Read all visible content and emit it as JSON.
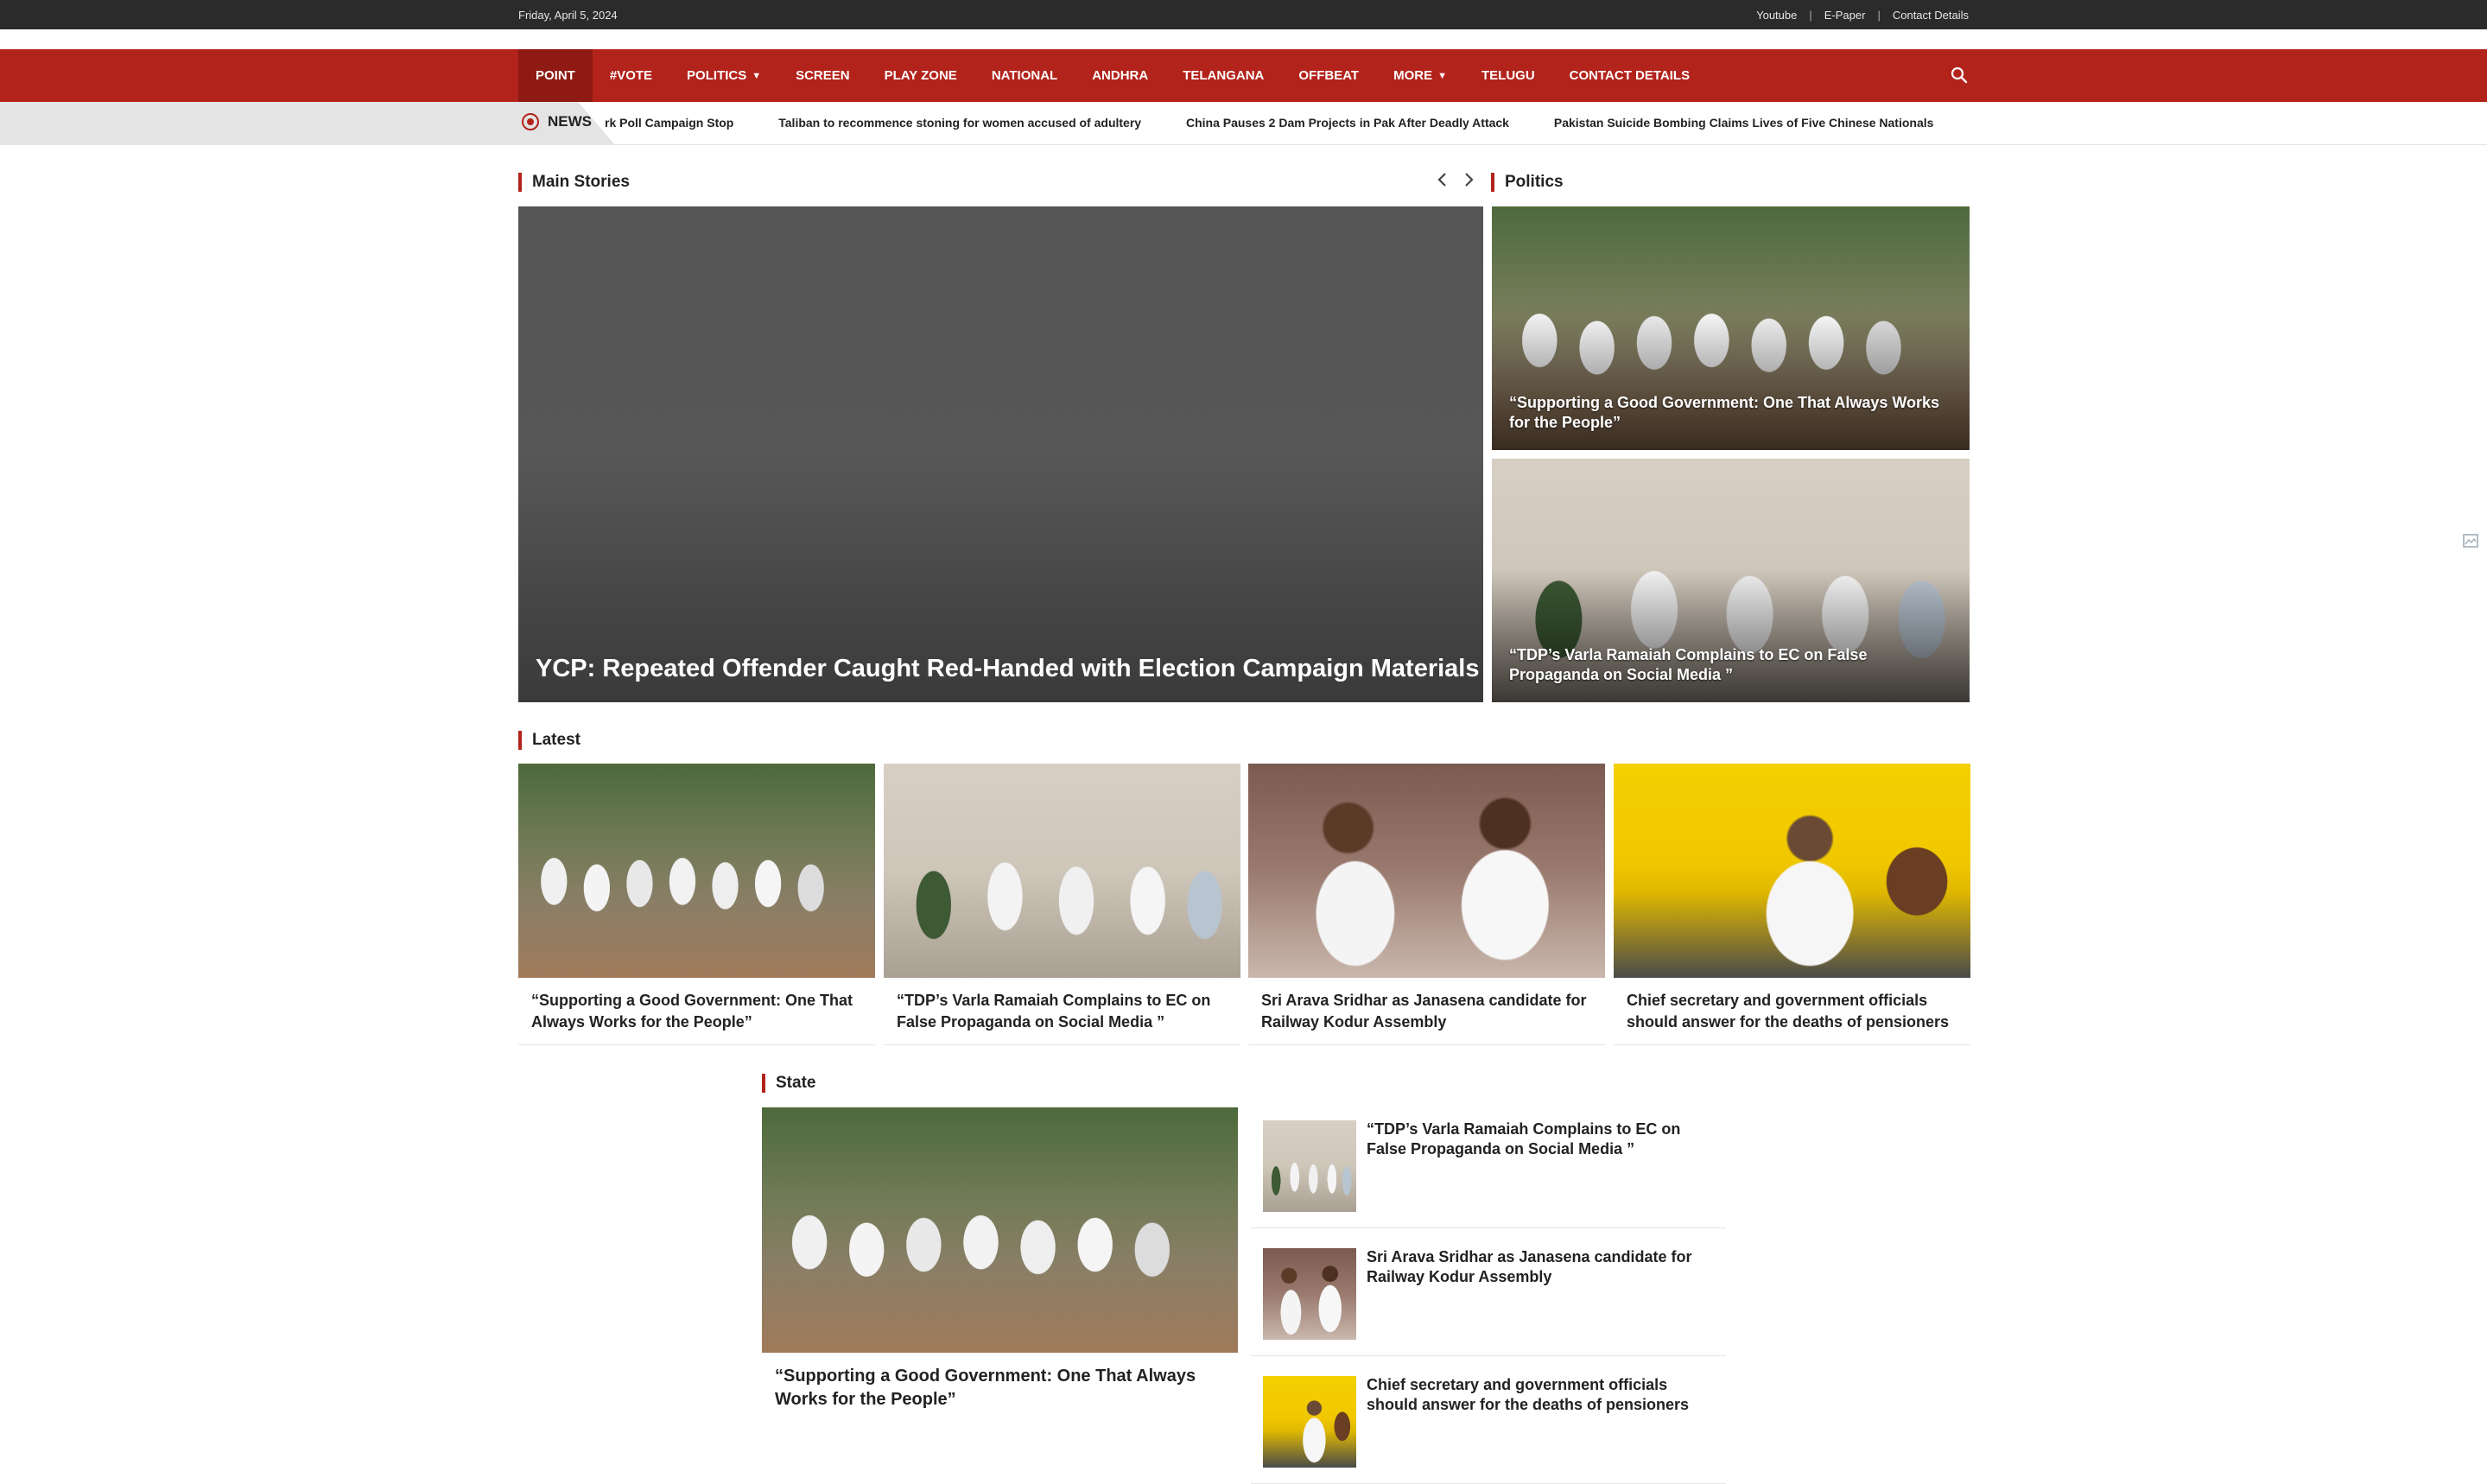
{
  "topbar": {
    "date": "Friday, April 5, 2024",
    "links": [
      "Youtube",
      "E-Paper",
      "Contact Details"
    ],
    "separator": "|"
  },
  "nav": {
    "items": [
      {
        "label": "POINT",
        "active": true
      },
      {
        "label": "#VOTE"
      },
      {
        "label": "POLITICS",
        "dropdown": true
      },
      {
        "label": "SCREEN"
      },
      {
        "label": "PLAY ZONE"
      },
      {
        "label": "NATIONAL"
      },
      {
        "label": "ANDHRA"
      },
      {
        "label": "TELANGANA"
      },
      {
        "label": "OFFBEAT"
      },
      {
        "label": "MORE",
        "dropdown": true
      },
      {
        "label": "TELUGU"
      },
      {
        "label": "CONTACT DETAILS"
      }
    ],
    "search_icon": "search-icon",
    "color": "#b2231b"
  },
  "ticker": {
    "label": "NEWS",
    "items": [
      "rk Poll Campaign Stop",
      "Taliban to recommence stoning for women accused of adultery",
      "China Pauses 2 Dam Projects in Pak After Deadly Attack",
      "Pakistan Suicide Bombing Claims Lives of Five Chinese Nationals"
    ]
  },
  "main_stories": {
    "heading": "Main Stories",
    "title": "YCP: Repeated Offender Caught Red-Handed with Election Campaign Materials"
  },
  "politics": {
    "heading": "Politics",
    "items": [
      {
        "title": "“Supporting a Good Government: One That Always Works for the People”"
      },
      {
        "title": "“TDP’s Varla Ramaiah Complains to EC on False Propaganda on Social Media ”"
      }
    ]
  },
  "latest": {
    "heading": "Latest",
    "items": [
      {
        "title": "“Supporting a Good Government: One That Always Works for the People”"
      },
      {
        "title": "“TDP’s Varla Ramaiah Complains to EC on False Propaganda on Social Media ”"
      },
      {
        "title": "Sri Arava Sridhar as Janasena candidate for Railway Kodur Assembly"
      },
      {
        "title": "Chief secretary and government officials should answer for the deaths of pensioners"
      }
    ]
  },
  "state": {
    "heading": "State",
    "main_title": "“Supporting a Good Government: One That Always Works for the People”",
    "items": [
      {
        "title": "“TDP’s Varla Ramaiah Complains to EC on False Propaganda on Social Media ”"
      },
      {
        "title": "Sri Arava Sridhar as Janasena candidate for Railway Kodur Assembly"
      },
      {
        "title": "Chief secretary and government officials should answer for the deaths of pensioners"
      }
    ]
  }
}
